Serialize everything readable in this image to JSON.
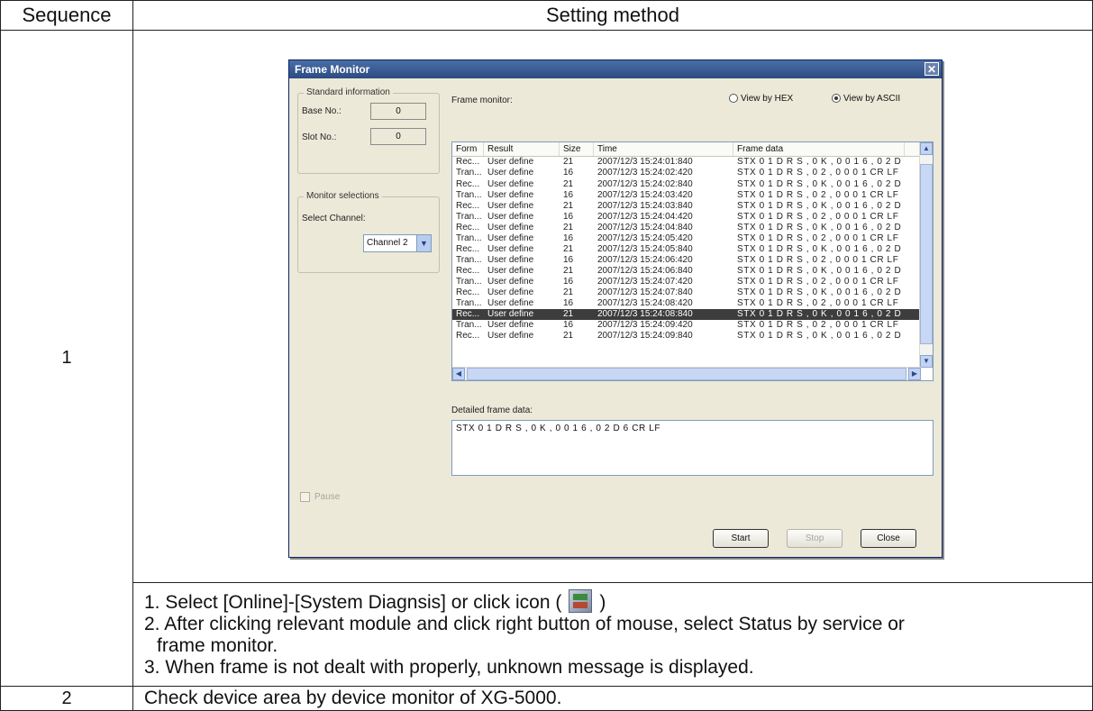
{
  "table": {
    "header_sequence": "Sequence",
    "header_method": "Setting method",
    "row1_sequence": "1",
    "row2_sequence": "2",
    "row2_text": "Check device area by device monitor of XG-5000."
  },
  "steps": {
    "step1_before": "1. Select [Online]-[System Diagnsis] or click icon (",
    "step1_after": ")",
    "step2_line1": "2. After clicking relevant module and click right button of mouse, select Status by service or",
    "step2_line2": "frame monitor.",
    "step3": "3. When frame is not dealt with properly, unknown message is displayed.",
    "icon": "system-diagnosis-icon"
  },
  "dialog": {
    "title": "Frame Monitor",
    "close_symbol": "✕",
    "standard_info": {
      "title": "Standard information",
      "base_label": "Base No.:",
      "base_value": "0",
      "slot_label": "Slot No.:",
      "slot_value": "0"
    },
    "monitor_selections": {
      "title": "Monitor selections",
      "channel_label": "Select Channel:",
      "channel_value": "Channel 2"
    },
    "pause_label": "Pause",
    "frame_monitor_label": "Frame monitor:",
    "view_hex_label": "View by HEX",
    "view_ascii_label": "View by ASCII",
    "view_mode": "ascii",
    "columns": [
      "Form",
      "Result",
      "Size",
      "Time",
      "Frame data"
    ],
    "rows": [
      [
        "Rec...",
        "User define",
        "21",
        "2007/12/3 15:24:01:840",
        "STX 0 1 D R S , 0 K , 0 0 1 6 , 0 2 D"
      ],
      [
        "Tran...",
        "User define",
        "16",
        "2007/12/3 15:24:02:420",
        "STX 0 1 D R S , 0 2 , 0 0 0 1 CR LF"
      ],
      [
        "Rec...",
        "User define",
        "21",
        "2007/12/3 15:24:02:840",
        "STX 0 1 D R S , 0 K , 0 0 1 6 , 0 2 D"
      ],
      [
        "Tran...",
        "User define",
        "16",
        "2007/12/3 15:24:03:420",
        "STX 0 1 D R S , 0 2 , 0 0 0 1 CR LF"
      ],
      [
        "Rec...",
        "User define",
        "21",
        "2007/12/3 15:24:03:840",
        "STX 0 1 D R S , 0 K , 0 0 1 6 , 0 2 D"
      ],
      [
        "Tran...",
        "User define",
        "16",
        "2007/12/3 15:24:04:420",
        "STX 0 1 D R S , 0 2 , 0 0 0 1 CR LF"
      ],
      [
        "Rec...",
        "User define",
        "21",
        "2007/12/3 15:24:04:840",
        "STX 0 1 D R S , 0 K , 0 0 1 6 , 0 2 D"
      ],
      [
        "Tran...",
        "User define",
        "16",
        "2007/12/3 15:24:05:420",
        "STX 0 1 D R S , 0 2 , 0 0 0 1 CR LF"
      ],
      [
        "Rec...",
        "User define",
        "21",
        "2007/12/3 15:24:05:840",
        "STX 0 1 D R S , 0 K , 0 0 1 6 , 0 2 D"
      ],
      [
        "Tran...",
        "User define",
        "16",
        "2007/12/3 15:24:06:420",
        "STX 0 1 D R S , 0 2 , 0 0 0 1 CR LF"
      ],
      [
        "Rec...",
        "User define",
        "21",
        "2007/12/3 15:24:06:840",
        "STX 0 1 D R S , 0 K , 0 0 1 6 , 0 2 D"
      ],
      [
        "Tran...",
        "User define",
        "16",
        "2007/12/3 15:24:07:420",
        "STX 0 1 D R S , 0 2 , 0 0 0 1 CR LF"
      ],
      [
        "Rec...",
        "User define",
        "21",
        "2007/12/3 15:24:07:840",
        "STX 0 1 D R S , 0 K , 0 0 1 6 , 0 2 D"
      ],
      [
        "Tran...",
        "User define",
        "16",
        "2007/12/3 15:24:08:420",
        "STX 0 1 D R S , 0 2 , 0 0 0 1 CR LF"
      ],
      [
        "Rec...",
        "User define",
        "21",
        "2007/12/3 15:24:08:840",
        "STX 0 1 D R S , 0 K , 0 0 1 6 , 0 2 D"
      ],
      [
        "Tran...",
        "User define",
        "16",
        "2007/12/3 15:24:09:420",
        "STX 0 1 D R S , 0 2 , 0 0 0 1 CR LF"
      ],
      [
        "Rec...",
        "User define",
        "21",
        "2007/12/3 15:24:09:840",
        "STX 0 1 D R S , 0 K , 0 0 1 6 , 0 2 D"
      ]
    ],
    "selected_row_index": 14,
    "detail_label": "Detailed frame data:",
    "detail_value": "STX 0 1 D R S , 0 K , 0 0 1 6 , 0 2 D 6 CR LF",
    "buttons": {
      "start": "Start",
      "stop": "Stop",
      "close": "Close"
    }
  }
}
